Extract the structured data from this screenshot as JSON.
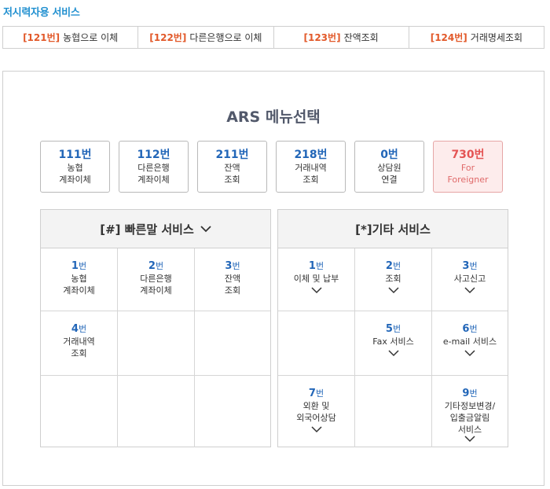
{
  "title": "저시력자용 서비스",
  "top_menu": [
    {
      "num": "[121번]",
      "label": "농협으로 이체"
    },
    {
      "num": "[122번]",
      "label": "다른은행으로 이체"
    },
    {
      "num": "[123번]",
      "label": "잔액조회"
    },
    {
      "num": "[124번]",
      "label": "거래명세조회"
    }
  ],
  "heading": "ARS 메뉴선택",
  "ars_buttons": [
    {
      "num": "111번",
      "line1": "농협",
      "line2": "계좌이체"
    },
    {
      "num": "112번",
      "line1": "다른은행",
      "line2": "계좌이체"
    },
    {
      "num": "211번",
      "line1": "잔액",
      "line2": "조회"
    },
    {
      "num": "218번",
      "line1": "거래내역",
      "line2": "조회"
    },
    {
      "num": "0번",
      "line1": "상담원",
      "line2": "연결"
    },
    {
      "num": "730번",
      "line1": "For",
      "line2": "Foreigner"
    }
  ],
  "quick_service": {
    "header": "[#] 빠른말 서비스",
    "items": [
      {
        "num": "1",
        "suffix": "번",
        "line1": "농협",
        "line2": "계좌이체"
      },
      {
        "num": "2",
        "suffix": "번",
        "line1": "다른은행",
        "line2": "계좌이체"
      },
      {
        "num": "3",
        "suffix": "번",
        "line1": "잔액",
        "line2": "조회"
      },
      {
        "num": "4",
        "suffix": "번",
        "line1": "거래내역",
        "line2": "조회"
      }
    ]
  },
  "other_service": {
    "header": "[*]기타 서비스",
    "items": [
      {
        "num": "1",
        "suffix": "번",
        "line1": "이체 및 납부"
      },
      {
        "num": "2",
        "suffix": "번",
        "line1": "조회"
      },
      {
        "num": "3",
        "suffix": "번",
        "line1": "사고신고"
      },
      {
        "num": "5",
        "suffix": "번",
        "line1": "Fax 서비스"
      },
      {
        "num": "6",
        "suffix": "번",
        "line1": "e-mail 서비스"
      },
      {
        "num": "7",
        "suffix": "번",
        "line1": "외환 및",
        "line2": "외국어상담"
      },
      {
        "num": "9",
        "suffix": "번",
        "line1": "기타정보변경/",
        "line2": "입출금알림",
        "line3": "서비스"
      }
    ]
  }
}
